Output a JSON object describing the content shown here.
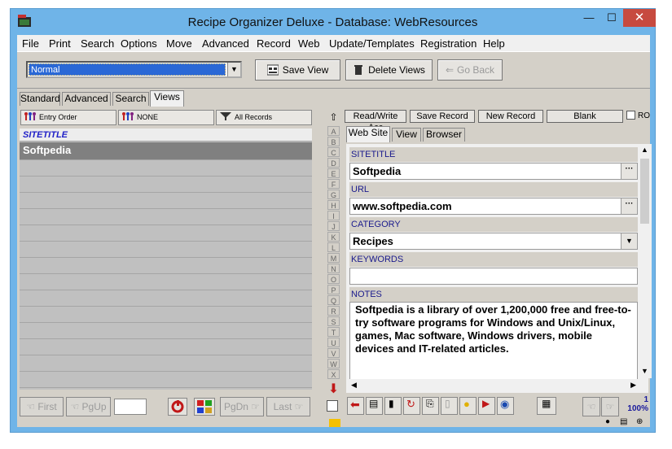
{
  "window": {
    "title": "Recipe Organizer Deluxe - Database: WebResources",
    "minimize": "—",
    "maximize": "☐",
    "close": "✕"
  },
  "menu": [
    "File",
    "Print",
    "Search",
    "Options",
    "Move",
    "Advanced",
    "Record",
    "Web",
    "Update/Templates",
    "Registration",
    "Help"
  ],
  "toolbar": {
    "view_selected": "Normal",
    "save_view": "Save View",
    "delete_views": "Delete Views",
    "go_back": "Go Back"
  },
  "left_tabs": [
    "Standard",
    "Advanced",
    "Search",
    "Views"
  ],
  "left_tab_active": "Views",
  "list_controls": {
    "order": "Entry Order",
    "filter": "NONE",
    "records": "All Records"
  },
  "list": {
    "column": "SITETITLE",
    "rows": [
      "Softpedia"
    ]
  },
  "alpha": [
    "A",
    "B",
    "C",
    "D",
    "E",
    "F",
    "G",
    "H",
    "I",
    "J",
    "K",
    "L",
    "M",
    "N",
    "O",
    "P",
    "Q",
    "R",
    "S",
    "T",
    "U",
    "V",
    "W",
    "X"
  ],
  "right_buttons": {
    "read_write": "Read/Write Acc",
    "save_record": "Save Record",
    "new_record": "New Record",
    "blank": "Blank",
    "ro": "RO"
  },
  "right_tabs": [
    "Web Site",
    "View",
    "Browser"
  ],
  "right_tab_active": "Web Site",
  "fields": {
    "sitetitle_label": "SITETITLE",
    "sitetitle_value": "Softpedia",
    "url_label": "URL",
    "url_value": "www.softpedia.com",
    "category_label": "CATEGORY",
    "category_value": "Recipes",
    "keywords_label": "KEYWORDS",
    "keywords_value": "",
    "notes_label": "NOTES",
    "notes_value": "Softpedia is a library of over 1,200,000 free and free-to-try software programs for Windows and Unix/Linux, games, Mac software, Windows drivers, mobile devices and IT-related articles.",
    "ellipsis": "···"
  },
  "nav": {
    "first": "First",
    "pgup": "PgUp",
    "pgdn": "PgDn",
    "last": "Last"
  },
  "record_count": {
    "current": "1",
    "zoom": "100%"
  }
}
